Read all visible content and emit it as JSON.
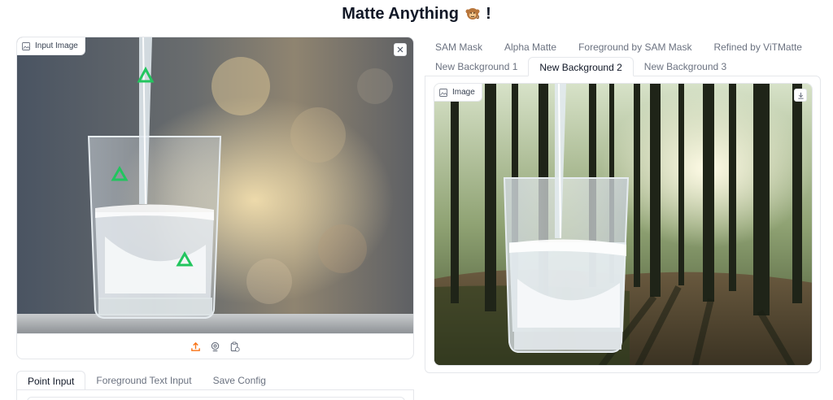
{
  "page": {
    "title": "Matte Anything",
    "title_suffix": "!"
  },
  "input_panel": {
    "label": "Input Image",
    "image_alt": "Glass of water being poured",
    "marker_color": "#22c55e",
    "source_icons": [
      "upload-icon",
      "webcam-icon",
      "clipboard-icon"
    ]
  },
  "bottom_tabs": {
    "items": [
      {
        "label": "Point Input",
        "active": true
      },
      {
        "label": "Foreground Text Input",
        "active": false
      },
      {
        "label": "Save Config",
        "active": false
      }
    ]
  },
  "output_tabs": {
    "row1": [
      {
        "label": "SAM Mask"
      },
      {
        "label": "Alpha Matte"
      },
      {
        "label": "Foreground by SAM Mask"
      },
      {
        "label": "Refined by ViTMatte"
      }
    ],
    "row2": [
      {
        "label": "New Background 1",
        "active": false
      },
      {
        "label": "New Background 2",
        "active": true
      },
      {
        "label": "New Background 3",
        "active": false
      }
    ]
  },
  "output_panel": {
    "label": "Image",
    "image_alt": "Glass of water composited on forest background"
  },
  "colors": {
    "accent": "#f97316",
    "border": "#e5e7eb",
    "text": "#111827",
    "muted": "#6b7280"
  }
}
